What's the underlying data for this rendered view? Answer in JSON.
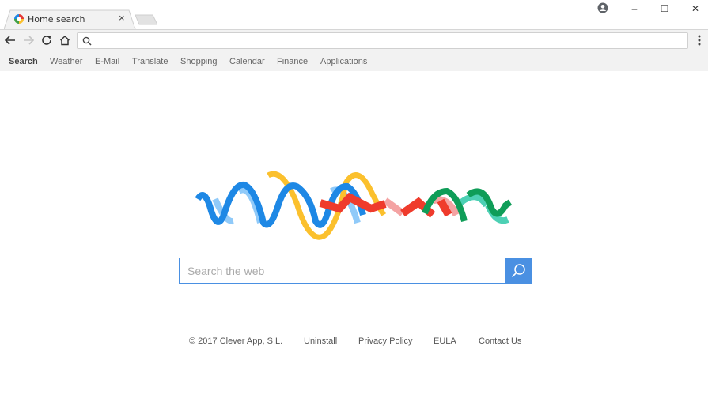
{
  "tab": {
    "title": "Home search",
    "close_symbol": "×"
  },
  "window": {
    "minimize": "–",
    "maximize": "☐",
    "close": "✕"
  },
  "omnibox": {
    "value": "",
    "placeholder": ""
  },
  "nav": {
    "items": [
      {
        "label": "Search",
        "active": true
      },
      {
        "label": "Weather",
        "active": false
      },
      {
        "label": "E-Mail",
        "active": false
      },
      {
        "label": "Translate",
        "active": false
      },
      {
        "label": "Shopping",
        "active": false
      },
      {
        "label": "Calendar",
        "active": false
      },
      {
        "label": "Finance",
        "active": false
      },
      {
        "label": "Applications",
        "active": false
      }
    ]
  },
  "search": {
    "placeholder": "Search the web",
    "value": ""
  },
  "footer": {
    "copyright": "© 2017 Clever App, S.L.",
    "links": [
      "Uninstall",
      "Privacy Policy",
      "EULA",
      "Contact Us"
    ]
  },
  "colors": {
    "accent": "#4a90e2",
    "logo_blue": "#1e88e5",
    "logo_light_blue": "#90caf9",
    "logo_yellow": "#fbc02d",
    "logo_red": "#ef3b2c",
    "logo_pink": "#f4a3a3",
    "logo_green": "#0f9d58",
    "logo_teal": "#4dd0b4"
  }
}
